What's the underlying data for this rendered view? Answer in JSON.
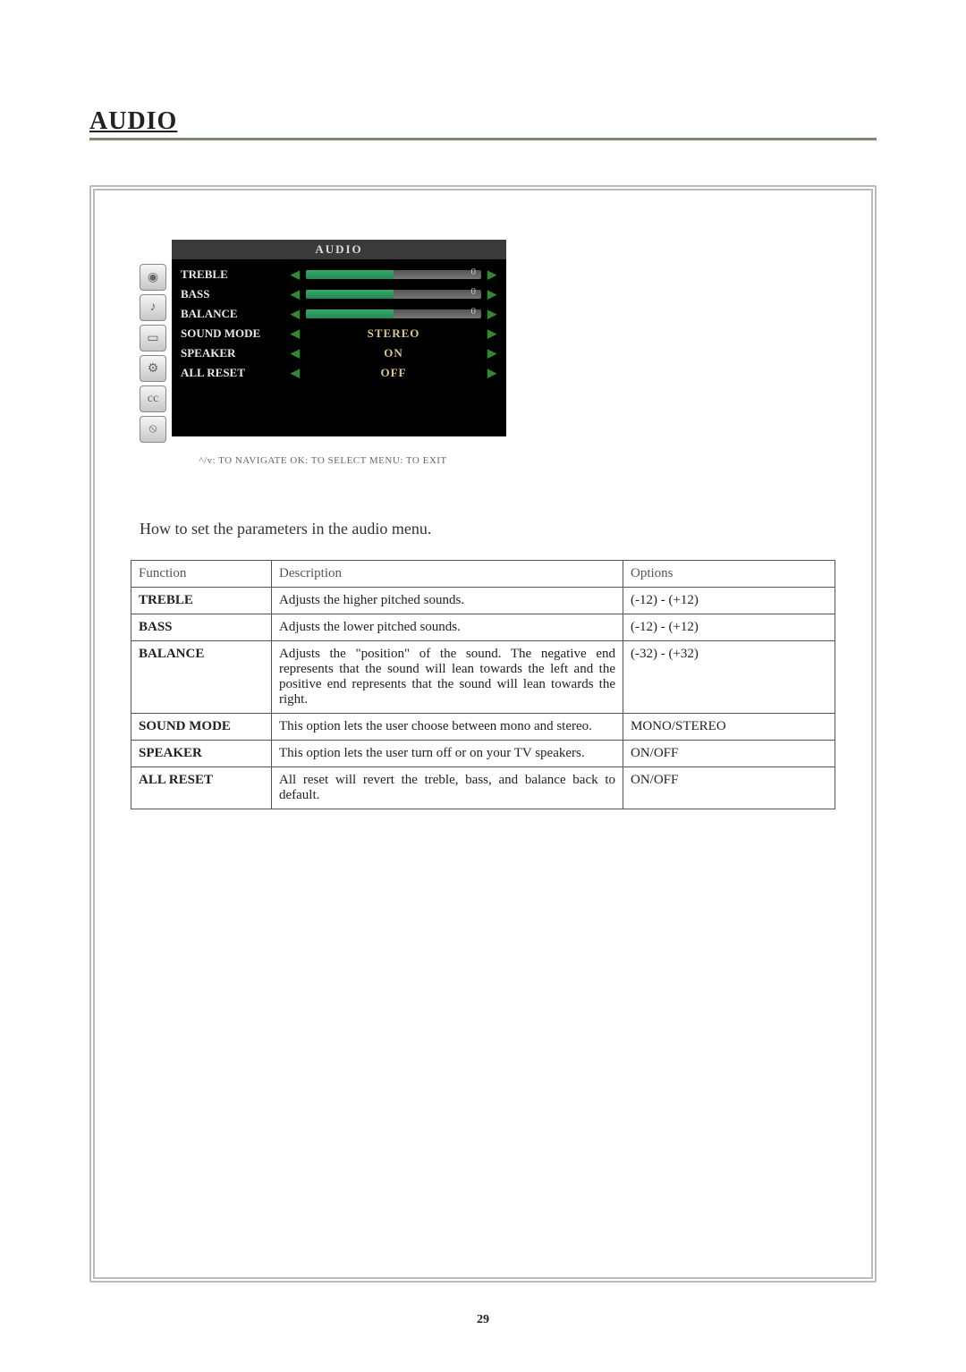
{
  "section_title": "AUDIO",
  "osd": {
    "title": "AUDIO",
    "rows": [
      {
        "label": "TREBLE",
        "type": "slider",
        "value": "0"
      },
      {
        "label": "BASS",
        "type": "slider",
        "value": "0"
      },
      {
        "label": "BALANCE",
        "type": "slider",
        "value": "0"
      },
      {
        "label": "SOUND MODE",
        "type": "text",
        "value": "STEREO"
      },
      {
        "label": "SPEAKER",
        "type": "text",
        "value": "ON"
      },
      {
        "label": "ALL RESET",
        "type": "text",
        "value": "OFF"
      }
    ],
    "hint": "^/v: TO NAVIGATE   OK: TO SELECT   MENU: TO EXIT"
  },
  "intro": "How to set the parameters in the audio menu.",
  "table": {
    "headers": [
      "Function",
      "Description",
      "Options"
    ],
    "rows": [
      {
        "fn": "TREBLE",
        "desc": "Adjusts the higher pitched sounds.",
        "opt": "(-12) - (+12)"
      },
      {
        "fn": "BASS",
        "desc": "Adjusts the lower pitched sounds.",
        "opt": "(-12) - (+12)"
      },
      {
        "fn": "BALANCE",
        "desc": "Adjusts the \"position\" of the sound. The negative end represents that the sound will lean towards the left and the positive end represents that the sound will lean towards the right.",
        "opt": "(-32) - (+32)"
      },
      {
        "fn": "SOUND MODE",
        "desc": "This option lets the user choose between mono and stereo.",
        "opt": "MONO/STEREO"
      },
      {
        "fn": "SPEAKER",
        "desc": "This option lets the user turn off or on your TV speakers.",
        "opt": "ON/OFF"
      },
      {
        "fn": "ALL RESET",
        "desc": "All reset will revert the treble, bass, and balance back to default.",
        "opt": "ON/OFF"
      }
    ]
  },
  "page_number": "29"
}
